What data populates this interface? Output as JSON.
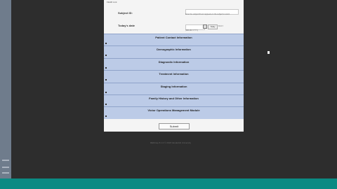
{
  "form": {
    "top_label": "FEHR Link",
    "subject_label": "Subject ID:",
    "subject_value": "",
    "subject_help": "Enter the subject ID as it appears on the subject's record.",
    "date_label": "Today's date",
    "date_value": "",
    "today_button_label": "Today",
    "date_hint": "M-D-Y",
    "date_format": "(MM-DD-YYYY)",
    "sections": [
      "Patient Contact Information",
      "Demographic Information",
      "Diagnostic Information",
      "Treatment Information",
      "Staging Information",
      "Family History and Other Information",
      "Victor Operations Management Module"
    ],
    "submit_label": "Submit"
  },
  "footer": "REDCap 8.1.0 © 2018 Vanderbilt University",
  "colors": {
    "section_bg": "#bccbe7",
    "bottom_bar": "#0b8a83",
    "backdrop": "#2d2d2d"
  }
}
